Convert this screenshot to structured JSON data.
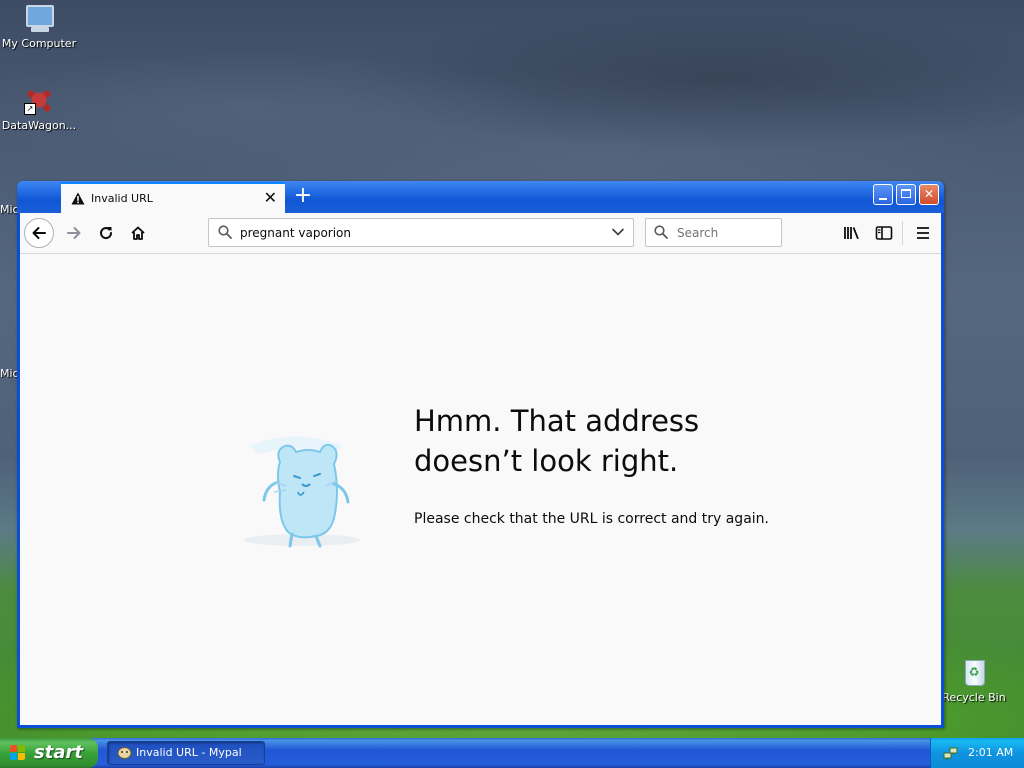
{
  "desktop": {
    "icons": [
      {
        "label": "My Computer",
        "icon": "computer-icon"
      },
      {
        "label": "DataWagon...",
        "icon": "datawagon-icon"
      },
      {
        "label": "Recycle Bin",
        "icon": "recycle-bin-icon"
      }
    ],
    "partial_labels": [
      "Mic",
      "Mic"
    ]
  },
  "browser": {
    "tab": {
      "title": "Invalid URL",
      "icon": "warning-icon"
    },
    "new_tab_label": "+",
    "url": "pregnant vaporion",
    "search_placeholder": "Search",
    "error": {
      "title": "Hmm. That address doesn’t look right.",
      "message": "Please check that the URL is correct and try again."
    }
  },
  "taskbar": {
    "start_label": "start",
    "task_item_label": "Invalid URL - Mypal",
    "clock": "2:01 AM"
  },
  "colors": {
    "tab_accent": "#0a84ff",
    "xp_titlebar": "#0f57d6",
    "start_green": "#39a339",
    "close_red": "#cf4b2a"
  }
}
